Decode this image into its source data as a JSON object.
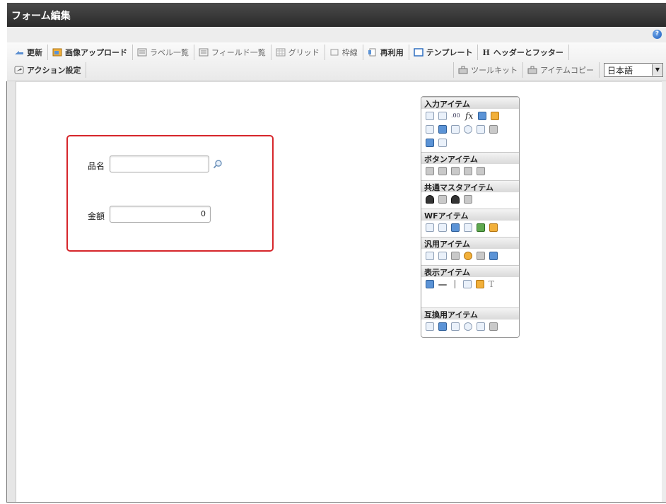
{
  "window": {
    "title": "フォーム編集"
  },
  "toolbar": {
    "row1": [
      {
        "label": "更新",
        "icon": "refresh-icon"
      },
      {
        "label": "画像アップロード",
        "icon": "image-upload-icon"
      },
      {
        "label": "ラベル一覧",
        "icon": "label-list-icon"
      },
      {
        "label": "フィールド一覧",
        "icon": "field-list-icon"
      },
      {
        "label": "グリッド",
        "icon": "grid-icon"
      },
      {
        "label": "枠線",
        "icon": "border-icon"
      },
      {
        "label": "再利用",
        "icon": "reuse-icon"
      },
      {
        "label": "テンプレート",
        "icon": "template-icon"
      },
      {
        "label": "ヘッダーとフッター",
        "icon": "header-footer-icon"
      }
    ],
    "row2_left": {
      "label": "アクション設定",
      "icon": "action-settings-icon"
    },
    "row2_right": [
      {
        "label": "ツールキット",
        "icon": "toolkit-icon"
      },
      {
        "label": "アイテムコピー",
        "icon": "item-copy-icon"
      }
    ],
    "language": {
      "value": "日本語"
    }
  },
  "form": {
    "fields": [
      {
        "label": "品名",
        "value": ""
      },
      {
        "label": "金額",
        "value": "0"
      }
    ]
  },
  "palette": {
    "sections": [
      {
        "title": "入力アイテム"
      },
      {
        "title": "ボタンアイテム"
      },
      {
        "title": "共通マスタアイテム"
      },
      {
        "title": "WFアイテム"
      },
      {
        "title": "汎用アイテム"
      },
      {
        "title": "表示アイテム"
      },
      {
        "title": "互換用アイテム"
      }
    ],
    "header_footer_glyph": "H",
    "fx_glyph": "fx",
    "num_glyph": ".00",
    "text_glyph": "T"
  },
  "colors": {
    "titlebar": "#2b2b2b",
    "selection": "#d6262b",
    "accent": "#1f5fbf"
  }
}
